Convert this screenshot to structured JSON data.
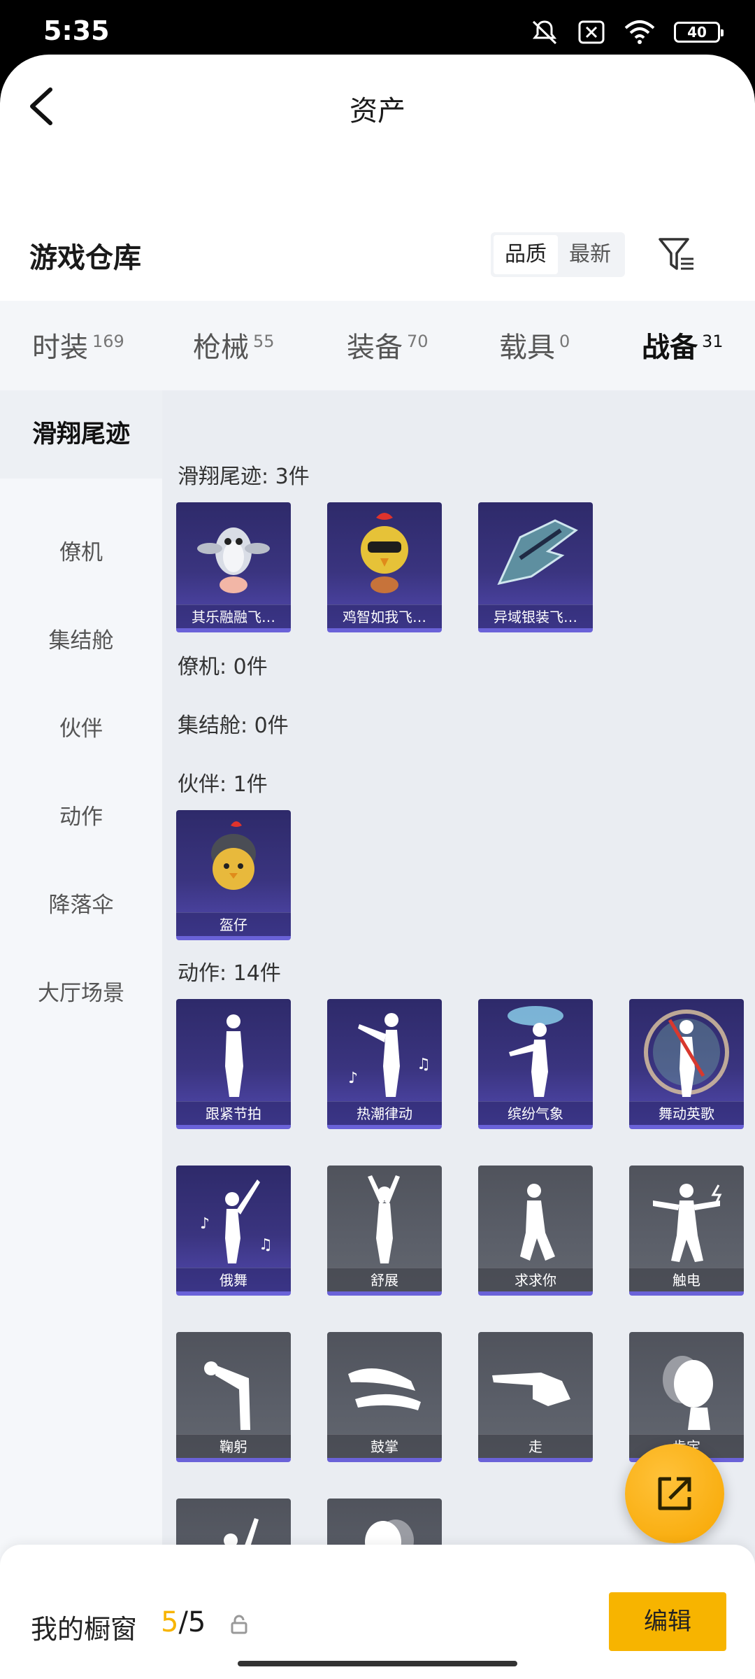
{
  "status": {
    "time": "5:35",
    "battery": "40"
  },
  "header": {
    "title": "资产"
  },
  "section": {
    "title": "游戏仓库",
    "sort_options": [
      "品质",
      "最新"
    ],
    "active_sort": "品质"
  },
  "tabs": [
    {
      "label": "时装",
      "count": "169"
    },
    {
      "label": "枪械",
      "count": "55"
    },
    {
      "label": "装备",
      "count": "70"
    },
    {
      "label": "载具",
      "count": "0"
    },
    {
      "label": "战备",
      "count": "31"
    }
  ],
  "active_tab": "战备",
  "sidebar": {
    "items": [
      "滑翔尾迹",
      "僚机",
      "集结舱",
      "伙伴",
      "动作",
      "降落伞",
      "大厅场景"
    ],
    "active": "滑翔尾迹"
  },
  "groups": {
    "glide": {
      "label": "滑翔尾迹: 3件",
      "items": [
        "其乐融融飞…",
        "鸡智如我飞…",
        "异域银装飞…"
      ]
    },
    "wingman": {
      "label": "僚机: 0件"
    },
    "rally": {
      "label": "集结舱: 0件"
    },
    "partner": {
      "label": "伙伴: 1件",
      "items": [
        "盔仔"
      ]
    },
    "emote": {
      "label": "动作: 14件",
      "items": [
        "跟紧节拍",
        "热潮律动",
        "缤纷气象",
        "舞动英歌",
        "俄舞",
        "舒展",
        "求求你",
        "触电",
        "鞠躬",
        "鼓掌",
        "走",
        "肯定"
      ]
    }
  },
  "bottom": {
    "label": "我的橱窗",
    "current": "5",
    "total": "/5",
    "edit_label": "编辑"
  },
  "colors": {
    "accent": "#f7b400",
    "rare_card": "#3a347f",
    "common_card": "#5b5f69"
  }
}
